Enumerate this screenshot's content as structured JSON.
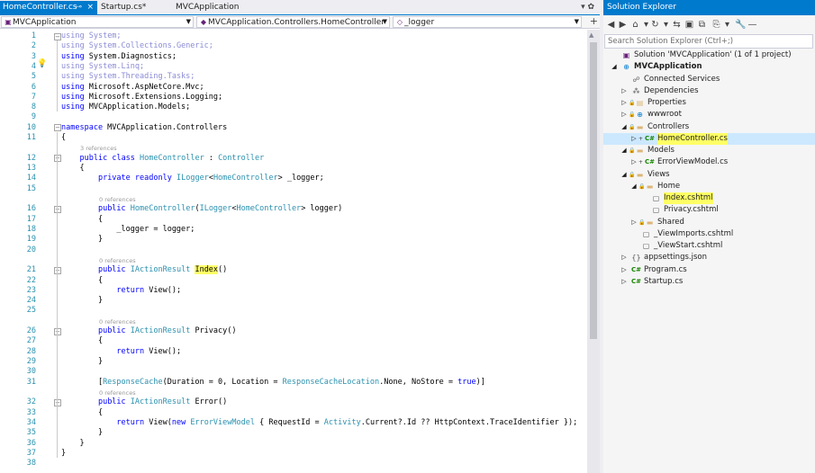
{
  "tabs": [
    {
      "label": "HomeController.cs",
      "close": "×",
      "pin": "⊸"
    },
    {
      "label": "Startup.cs*"
    },
    {
      "label": "MVCApplication"
    }
  ],
  "tabbar_right": "▾ ✿",
  "nav": {
    "project": "MVCApplication",
    "class": "MVCApplication.Controllers.HomeController",
    "member": "_logger",
    "split": "+"
  },
  "code": {
    "lines": [
      {
        "n": "1",
        "segs": [
          {
            "c": "kd",
            "t": "using"
          },
          {
            "c": "t",
            "t": " "
          },
          {
            "c": "kd2",
            "t": "System;"
          }
        ]
      },
      {
        "n": "2",
        "segs": [
          {
            "c": "kd",
            "t": "using"
          },
          {
            "c": "p",
            "t": " "
          },
          {
            "c": "kd2",
            "t": "System.Collections.Generic;"
          }
        ]
      },
      {
        "n": "3",
        "segs": [
          {
            "c": "k",
            "t": "using"
          },
          {
            "c": "p",
            "t": " System.Diagnostics;"
          }
        ]
      },
      {
        "n": "4",
        "segs": [
          {
            "c": "kd",
            "t": "using"
          },
          {
            "c": "p",
            "t": " "
          },
          {
            "c": "kd2",
            "t": "System.Linq;"
          }
        ]
      },
      {
        "n": "5",
        "segs": [
          {
            "c": "kd",
            "t": "using"
          },
          {
            "c": "p",
            "t": " "
          },
          {
            "c": "kd2",
            "t": "System.Threading.Tasks;"
          }
        ]
      },
      {
        "n": "6",
        "segs": [
          {
            "c": "k",
            "t": "using"
          },
          {
            "c": "p",
            "t": " Microsoft.AspNetCore.Mvc;"
          }
        ]
      },
      {
        "n": "7",
        "segs": [
          {
            "c": "k",
            "t": "using"
          },
          {
            "c": "p",
            "t": " Microsoft.Extensions.Logging;"
          }
        ]
      },
      {
        "n": "8",
        "segs": [
          {
            "c": "k",
            "t": "using"
          },
          {
            "c": "p",
            "t": " MVCApplication.Models;"
          }
        ]
      },
      {
        "n": "9",
        "segs": []
      },
      {
        "n": "10",
        "segs": [
          {
            "c": "k",
            "t": "namespace"
          },
          {
            "c": "p",
            "t": " MVCApplication.Controllers"
          }
        ]
      },
      {
        "n": "11",
        "segs": [
          {
            "c": "p",
            "t": "{"
          }
        ]
      },
      {
        "n": "12",
        "segs": [
          {
            "c": "p",
            "t": "    "
          },
          {
            "c": "k",
            "t": "public"
          },
          {
            "c": "p",
            "t": " "
          },
          {
            "c": "k",
            "t": "class"
          },
          {
            "c": "p",
            "t": " "
          },
          {
            "c": "t",
            "t": "HomeController"
          },
          {
            "c": "p",
            "t": " : "
          },
          {
            "c": "t",
            "t": "Controller"
          }
        ]
      },
      {
        "n": "13",
        "segs": [
          {
            "c": "p",
            "t": "    {"
          }
        ]
      },
      {
        "n": "14",
        "segs": [
          {
            "c": "p",
            "t": "        "
          },
          {
            "c": "k",
            "t": "private"
          },
          {
            "c": "p",
            "t": " "
          },
          {
            "c": "k",
            "t": "readonly"
          },
          {
            "c": "p",
            "t": " "
          },
          {
            "c": "t",
            "t": "ILogger"
          },
          {
            "c": "p",
            "t": "<"
          },
          {
            "c": "t",
            "t": "HomeController"
          },
          {
            "c": "p",
            "t": "> _logger;"
          }
        ]
      },
      {
        "n": "15",
        "segs": []
      },
      {
        "n": "16",
        "segs": [
          {
            "c": "p",
            "t": "        "
          },
          {
            "c": "k",
            "t": "public"
          },
          {
            "c": "p",
            "t": " "
          },
          {
            "c": "t",
            "t": "HomeController"
          },
          {
            "c": "p",
            "t": "("
          },
          {
            "c": "t",
            "t": "ILogger"
          },
          {
            "c": "p",
            "t": "<"
          },
          {
            "c": "t",
            "t": "HomeController"
          },
          {
            "c": "p",
            "t": "> logger)"
          }
        ]
      },
      {
        "n": "17",
        "segs": [
          {
            "c": "p",
            "t": "        {"
          }
        ]
      },
      {
        "n": "18",
        "segs": [
          {
            "c": "p",
            "t": "            _logger = logger;"
          }
        ]
      },
      {
        "n": "19",
        "segs": [
          {
            "c": "p",
            "t": "        }"
          }
        ]
      },
      {
        "n": "20",
        "segs": []
      },
      {
        "n": "21",
        "segs": [
          {
            "c": "p",
            "t": "        "
          },
          {
            "c": "k",
            "t": "public"
          },
          {
            "c": "p",
            "t": " "
          },
          {
            "c": "t",
            "t": "IActionResult"
          },
          {
            "c": "p",
            "t": " "
          },
          {
            "c": "hl",
            "t": "Index"
          },
          {
            "c": "p",
            "t": "()"
          }
        ]
      },
      {
        "n": "22",
        "segs": [
          {
            "c": "p",
            "t": "        {"
          }
        ]
      },
      {
        "n": "23",
        "segs": [
          {
            "c": "p",
            "t": "            "
          },
          {
            "c": "k",
            "t": "return"
          },
          {
            "c": "p",
            "t": " View();"
          }
        ]
      },
      {
        "n": "24",
        "segs": [
          {
            "c": "p",
            "t": "        }"
          }
        ]
      },
      {
        "n": "25",
        "segs": []
      },
      {
        "n": "26",
        "segs": [
          {
            "c": "p",
            "t": "        "
          },
          {
            "c": "k",
            "t": "public"
          },
          {
            "c": "p",
            "t": " "
          },
          {
            "c": "t",
            "t": "IActionResult"
          },
          {
            "c": "p",
            "t": " Privacy()"
          }
        ]
      },
      {
        "n": "27",
        "segs": [
          {
            "c": "p",
            "t": "        {"
          }
        ]
      },
      {
        "n": "28",
        "segs": [
          {
            "c": "p",
            "t": "            "
          },
          {
            "c": "k",
            "t": "return"
          },
          {
            "c": "p",
            "t": " View();"
          }
        ]
      },
      {
        "n": "29",
        "segs": [
          {
            "c": "p",
            "t": "        }"
          }
        ]
      },
      {
        "n": "30",
        "segs": []
      },
      {
        "n": "31",
        "segs": [
          {
            "c": "p",
            "t": "        ["
          },
          {
            "c": "t",
            "t": "ResponseCache"
          },
          {
            "c": "p",
            "t": "(Duration = 0, Location = "
          },
          {
            "c": "t",
            "t": "ResponseCacheLocation"
          },
          {
            "c": "p",
            "t": ".None, NoStore = "
          },
          {
            "c": "k",
            "t": "true"
          },
          {
            "c": "p",
            "t": ")]"
          }
        ]
      },
      {
        "n": "32",
        "segs": [
          {
            "c": "p",
            "t": "        "
          },
          {
            "c": "k",
            "t": "public"
          },
          {
            "c": "p",
            "t": " "
          },
          {
            "c": "t",
            "t": "IActionResult"
          },
          {
            "c": "p",
            "t": " Error()"
          }
        ]
      },
      {
        "n": "33",
        "segs": [
          {
            "c": "p",
            "t": "        {"
          }
        ]
      },
      {
        "n": "34",
        "segs": [
          {
            "c": "p",
            "t": "            "
          },
          {
            "c": "k",
            "t": "return"
          },
          {
            "c": "p",
            "t": " View("
          },
          {
            "c": "k",
            "t": "new"
          },
          {
            "c": "p",
            "t": " "
          },
          {
            "c": "t",
            "t": "ErrorViewModel"
          },
          {
            "c": "p",
            "t": " { RequestId = "
          },
          {
            "c": "t",
            "t": "Activity"
          },
          {
            "c": "p",
            "t": ".Current?.Id ?? HttpContext.TraceIdentifier });"
          }
        ]
      },
      {
        "n": "35",
        "segs": [
          {
            "c": "p",
            "t": "        }"
          }
        ]
      },
      {
        "n": "36",
        "segs": [
          {
            "c": "p",
            "t": "    }"
          }
        ]
      },
      {
        "n": "37",
        "segs": [
          {
            "c": "p",
            "t": "}"
          }
        ]
      },
      {
        "n": "38",
        "segs": []
      }
    ],
    "lens": [
      {
        "after": "11",
        "text": "3 references"
      },
      {
        "after": "15",
        "text": "0 references"
      },
      {
        "after": "20",
        "text": "0 references"
      },
      {
        "after": "25",
        "text": "0 references"
      },
      {
        "after": "31",
        "text": "0 references"
      }
    ]
  },
  "solution_explorer": {
    "title": "Solution Explorer",
    "search_placeholder": "Search Solution Explorer (Ctrl+;)",
    "toolbar": [
      "◀",
      "▶",
      "⌂",
      "▾",
      "↻",
      "▾",
      "⇆",
      "▣",
      "⧉",
      "⎘",
      "▾",
      "🔧",
      "—"
    ],
    "tree": [
      {
        "depth": 0,
        "exp": "",
        "icon": "▣",
        "icon_class": "ico-sln",
        "label": "Solution 'MVCApplication' (1 of 1 project)",
        "bold": false,
        "sel": false,
        "highlight": false
      },
      {
        "depth": 0,
        "exp": "◢",
        "icon": "⊕",
        "icon_class": "ico-web",
        "label": "MVCApplication",
        "bold": true,
        "sel": false,
        "highlight": false
      },
      {
        "depth": 1,
        "exp": "",
        "icon": "☍",
        "icon_class": "ico-file",
        "label": "Connected Services",
        "bold": false,
        "sel": false,
        "highlight": false
      },
      {
        "depth": 1,
        "exp": "▷",
        "icon": "⁂",
        "icon_class": "ico-file",
        "label": "Dependencies",
        "bold": false,
        "sel": false,
        "highlight": false
      },
      {
        "depth": 1,
        "exp": "▷",
        "icon": "▤",
        "icon_class": "ico-folder",
        "label": "Properties",
        "bold": false,
        "sel": false,
        "highlight": false,
        "lock": true
      },
      {
        "depth": 1,
        "exp": "▷",
        "icon": "⊕",
        "icon_class": "ico-web",
        "label": "wwwroot",
        "bold": false,
        "sel": false,
        "highlight": false,
        "lock": true
      },
      {
        "depth": 1,
        "exp": "◢",
        "icon": "▬",
        "icon_class": "ico-folder",
        "label": "Controllers",
        "bold": false,
        "sel": false,
        "highlight": false,
        "lock": true
      },
      {
        "depth": 2,
        "exp": "▷",
        "icon": "C#",
        "icon_class": "ico-cs",
        "label": "HomeController.cs",
        "bold": false,
        "sel": true,
        "highlight": true,
        "plus": true
      },
      {
        "depth": 1,
        "exp": "◢",
        "icon": "▬",
        "icon_class": "ico-folder",
        "label": "Models",
        "bold": false,
        "sel": false,
        "highlight": false,
        "lock": true
      },
      {
        "depth": 2,
        "exp": "▷",
        "icon": "C#",
        "icon_class": "ico-cs",
        "label": "ErrorViewModel.cs",
        "bold": false,
        "sel": false,
        "highlight": false,
        "plus": true
      },
      {
        "depth": 1,
        "exp": "◢",
        "icon": "▬",
        "icon_class": "ico-folder",
        "label": "Views",
        "bold": false,
        "sel": false,
        "highlight": false,
        "lock": true
      },
      {
        "depth": 2,
        "exp": "◢",
        "icon": "▬",
        "icon_class": "ico-folder",
        "label": "Home",
        "bold": false,
        "sel": false,
        "highlight": false,
        "lock": true
      },
      {
        "depth": 3,
        "exp": "",
        "icon": "▢",
        "icon_class": "ico-file",
        "label": "Index.cshtml",
        "bold": false,
        "sel": false,
        "highlight": true
      },
      {
        "depth": 3,
        "exp": "",
        "icon": "▢",
        "icon_class": "ico-file",
        "label": "Privacy.cshtml",
        "bold": false,
        "sel": false,
        "highlight": false
      },
      {
        "depth": 2,
        "exp": "▷",
        "icon": "▬",
        "icon_class": "ico-folder",
        "label": "Shared",
        "bold": false,
        "sel": false,
        "highlight": false,
        "lock": true
      },
      {
        "depth": 2,
        "exp": "",
        "icon": "▢",
        "icon_class": "ico-file",
        "label": "_ViewImports.cshtml",
        "bold": false,
        "sel": false,
        "highlight": false
      },
      {
        "depth": 2,
        "exp": "",
        "icon": "▢",
        "icon_class": "ico-file",
        "label": "_ViewStart.cshtml",
        "bold": false,
        "sel": false,
        "highlight": false
      },
      {
        "depth": 1,
        "exp": "▷",
        "icon": "{}",
        "icon_class": "ico-file",
        "label": "appsettings.json",
        "bold": false,
        "sel": false,
        "highlight": false
      },
      {
        "depth": 1,
        "exp": "▷",
        "icon": "C#",
        "icon_class": "ico-cs",
        "label": "Program.cs",
        "bold": false,
        "sel": false,
        "highlight": false
      },
      {
        "depth": 1,
        "exp": "▷",
        "icon": "C#",
        "icon_class": "ico-cs",
        "label": "Startup.cs",
        "bold": false,
        "sel": false,
        "highlight": false
      }
    ]
  },
  "colors": {
    "accent": "#007acc",
    "keyword": "#0000ff",
    "type": "#2b91af",
    "highlight": "#ffff66",
    "selection": "#cce8ff"
  }
}
